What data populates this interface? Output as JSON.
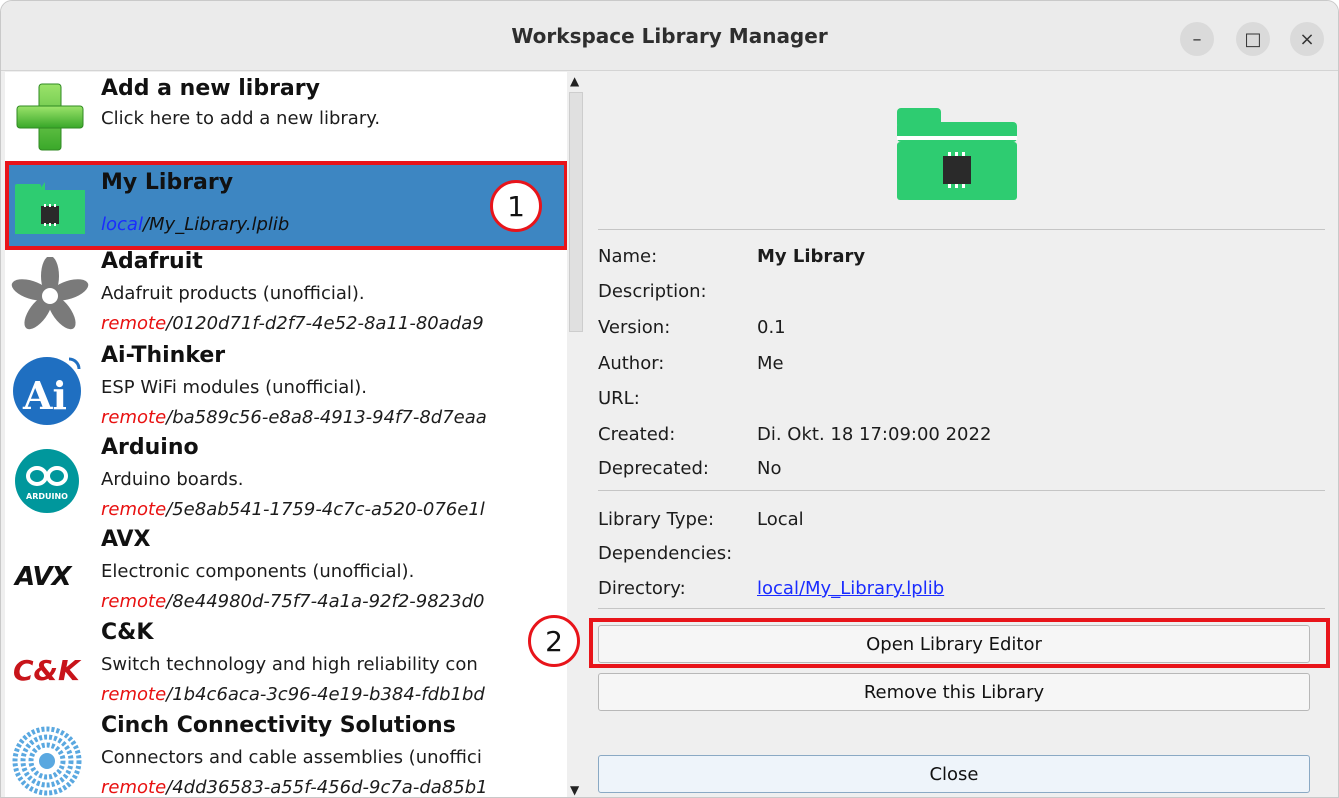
{
  "window": {
    "title": "Workspace Library Manager",
    "minimize_label": "–",
    "maximize_label": "□",
    "close_label": "×"
  },
  "libraries": [
    {
      "name": "Add a new library",
      "desc": "Click here to add a new library.",
      "icon": "add-icon"
    },
    {
      "name": "My Library",
      "path_prefix": "local",
      "path_rest": "/My_Library.lplib",
      "icon": "folder-chip-icon",
      "selected": true
    },
    {
      "name": "Adafruit",
      "desc": "Adafruit products (unofficial).",
      "path_prefix": "remote",
      "path_rest": "/0120d71f-d2f7-4e52-8a11-80ada9",
      "icon": "adafruit-logo-icon"
    },
    {
      "name": "Ai-Thinker",
      "desc": "ESP WiFi modules (unofficial).",
      "path_prefix": "remote",
      "path_rest": "/ba589c56-e8a8-4913-94f7-8d7eaa",
      "icon": "ai-thinker-logo-icon"
    },
    {
      "name": "Arduino",
      "desc": "Arduino boards.",
      "path_prefix": "remote",
      "path_rest": "/5e8ab541-1759-4c7c-a520-076e1l",
      "icon": "arduino-logo-icon"
    },
    {
      "name": "AVX",
      "desc": "Electronic components (unofficial).",
      "path_prefix": "remote",
      "path_rest": "/8e44980d-75f7-4a1a-92f2-9823d0",
      "icon": "avx-logo-icon"
    },
    {
      "name": "C&K",
      "desc": "Switch technology and high reliability con",
      "path_prefix": "remote",
      "path_rest": "/1b4c6aca-3c96-4e19-b384-fdb1bd",
      "icon": "ck-logo-icon"
    },
    {
      "name": "Cinch Connectivity Solutions",
      "desc": "Connectors and cable assemblies (unoffici",
      "path_prefix": "remote",
      "path_rest": "/4dd36583-a55f-456d-9c7a-da85b1",
      "icon": "cinch-logo-icon"
    }
  ],
  "logos": {
    "arduino_text": "ARDUINO",
    "ai_text": "Ai",
    "avx_text": "AVX",
    "ck_text": "C&K"
  },
  "annotations": {
    "badge1": "1",
    "badge2": "2"
  },
  "details": {
    "labels": {
      "name": "Name:",
      "description": "Description:",
      "version": "Version:",
      "author": "Author:",
      "url": "URL:",
      "created": "Created:",
      "deprecated": "Deprecated:",
      "library_type": "Library Type:",
      "dependencies": "Dependencies:",
      "directory": "Directory:"
    },
    "values": {
      "name": "My Library",
      "description": "",
      "version": "0.1",
      "author": "Me",
      "url": "",
      "created": "Di. Okt. 18 17:09:00 2022",
      "deprecated": "No",
      "library_type": "Local",
      "dependencies": "",
      "directory": "local/My_Library.lplib"
    }
  },
  "buttons": {
    "open_editor": "Open Library Editor",
    "remove": "Remove this Library",
    "close": "Close"
  },
  "colors": {
    "selection": "#3d86c2",
    "folder_green": "#2ecc71",
    "annotation_red": "#e8141a",
    "remote_red": "#e81010",
    "local_blue": "#1a2cff"
  }
}
